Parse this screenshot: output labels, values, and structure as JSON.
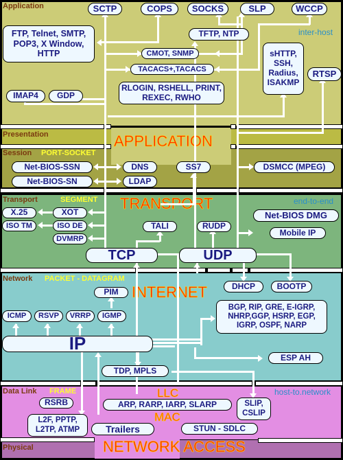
{
  "layers": {
    "application": {
      "name": "Application",
      "note": "inter-host"
    },
    "presentation": {
      "name": "Presentation"
    },
    "session": {
      "name": "Session",
      "tag": "PORT-SOCKET"
    },
    "transport": {
      "name": "Transport",
      "tag": "SEGMENT",
      "note": "end-to-end"
    },
    "network": {
      "name": "Network",
      "tag": "PACKET - DATAGRAM"
    },
    "datalink": {
      "name": "Data Link",
      "tag": "FRAME",
      "note": "host-to.network"
    },
    "physical": {
      "name": "Physical"
    }
  },
  "big_labels": {
    "application": "APPLICATION",
    "transport": "TRANSPORT",
    "internet": "INTERNET",
    "llc": "LLC",
    "mac": "MAC",
    "network_access": "NETWORK ACCESS"
  },
  "protocols": {
    "sctp": "SCTP",
    "cops": "COPS",
    "socks": "SOCKS",
    "slp": "SLP",
    "wccp": "WCCP",
    "ftp": "FTP, Telnet, SMTP, POP3,  X Window, HTTP",
    "tftp": "TFTP, NTP",
    "cmot": "CMOT, SNMP",
    "tacacs": "TACACS+,TACACS",
    "shttp": "sHTTP, SSH, Radius, ISAKMP",
    "rtsp": "RTSP",
    "rlogin": "RLOGIN, RSHELL, PRINT, REXEC, RWHO",
    "imap4": "IMAP4",
    "gdp": "GDP",
    "netbios_ssn": "Net-BIOS-SSN",
    "netbios_sn": "Net-BIOS-SN",
    "dns": "DNS",
    "ldap": "LDAP",
    "ss7": "SS7",
    "dsmcc": "DSMCC (MPEG)",
    "x25": "X.25",
    "xot": "XOT",
    "iso_tm": "ISO TM",
    "iso_de": "ISO DE",
    "dvmrp": "DVMRP",
    "tali": "TALI",
    "rudp": "RUDP",
    "netbios_dmg": "Net-BIOS DMG",
    "mobile_ip": "Mobile IP",
    "tcp": "TCP",
    "udp": "UDP",
    "pim": "PIM",
    "dhcp": "DHCP",
    "bootp": "BOOTP",
    "icmp": "ICMP",
    "rsvp": "RSVP",
    "vrrp": "VRRP",
    "igmp": "IGMP",
    "bgp": "BGP, RIP, GRE, E-IGRP, NHRP,GGP, HSRP, EGP, IGRP, OSPF, NARP",
    "ip": "IP",
    "esp_ah": "ESP AH",
    "tdp_mpls": "TDP, MPLS",
    "rsrb": "RSRB",
    "l2f": "L2F, PPTP, L2TP, ATMP",
    "arp": "ARP, RARP, IARP, SLARP",
    "slip": "SLIP, CSLIP",
    "trailers": "Trailers",
    "stun": "STUN - SDLC"
  }
}
